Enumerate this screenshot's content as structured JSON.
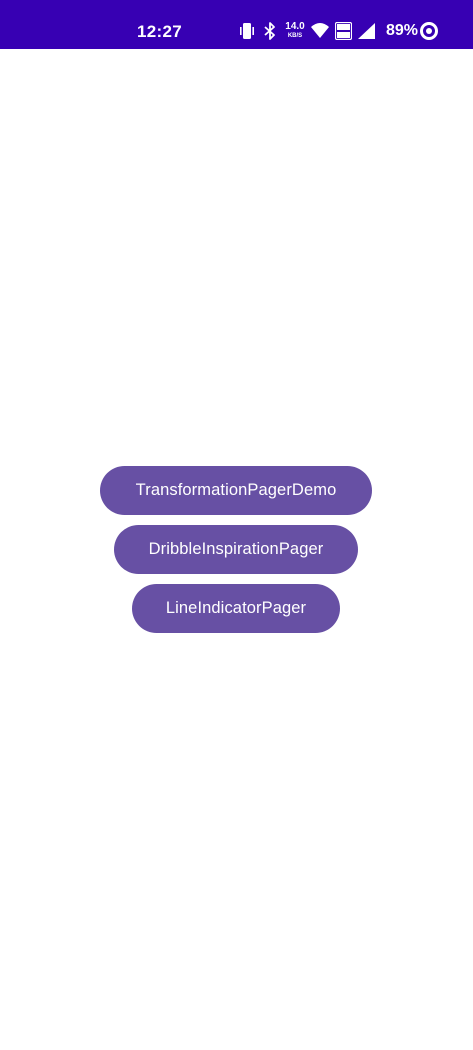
{
  "status_bar": {
    "time": "12:27",
    "network_speed": "14.0",
    "network_speed_unit": "KB/S",
    "battery_percent": "89%",
    "icons": [
      "vibrate-icon",
      "bluetooth-icon",
      "wifi-icon",
      "volte-icon",
      "signal-icon",
      "battery-icon"
    ],
    "background_color": "#3700b3"
  },
  "buttons": [
    {
      "label": "TransformationPagerDemo"
    },
    {
      "label": "DribbleInspirationPager"
    },
    {
      "label": "LineIndicatorPager"
    }
  ],
  "colors": {
    "accent": "#6750a4",
    "background": "#ffffff"
  }
}
